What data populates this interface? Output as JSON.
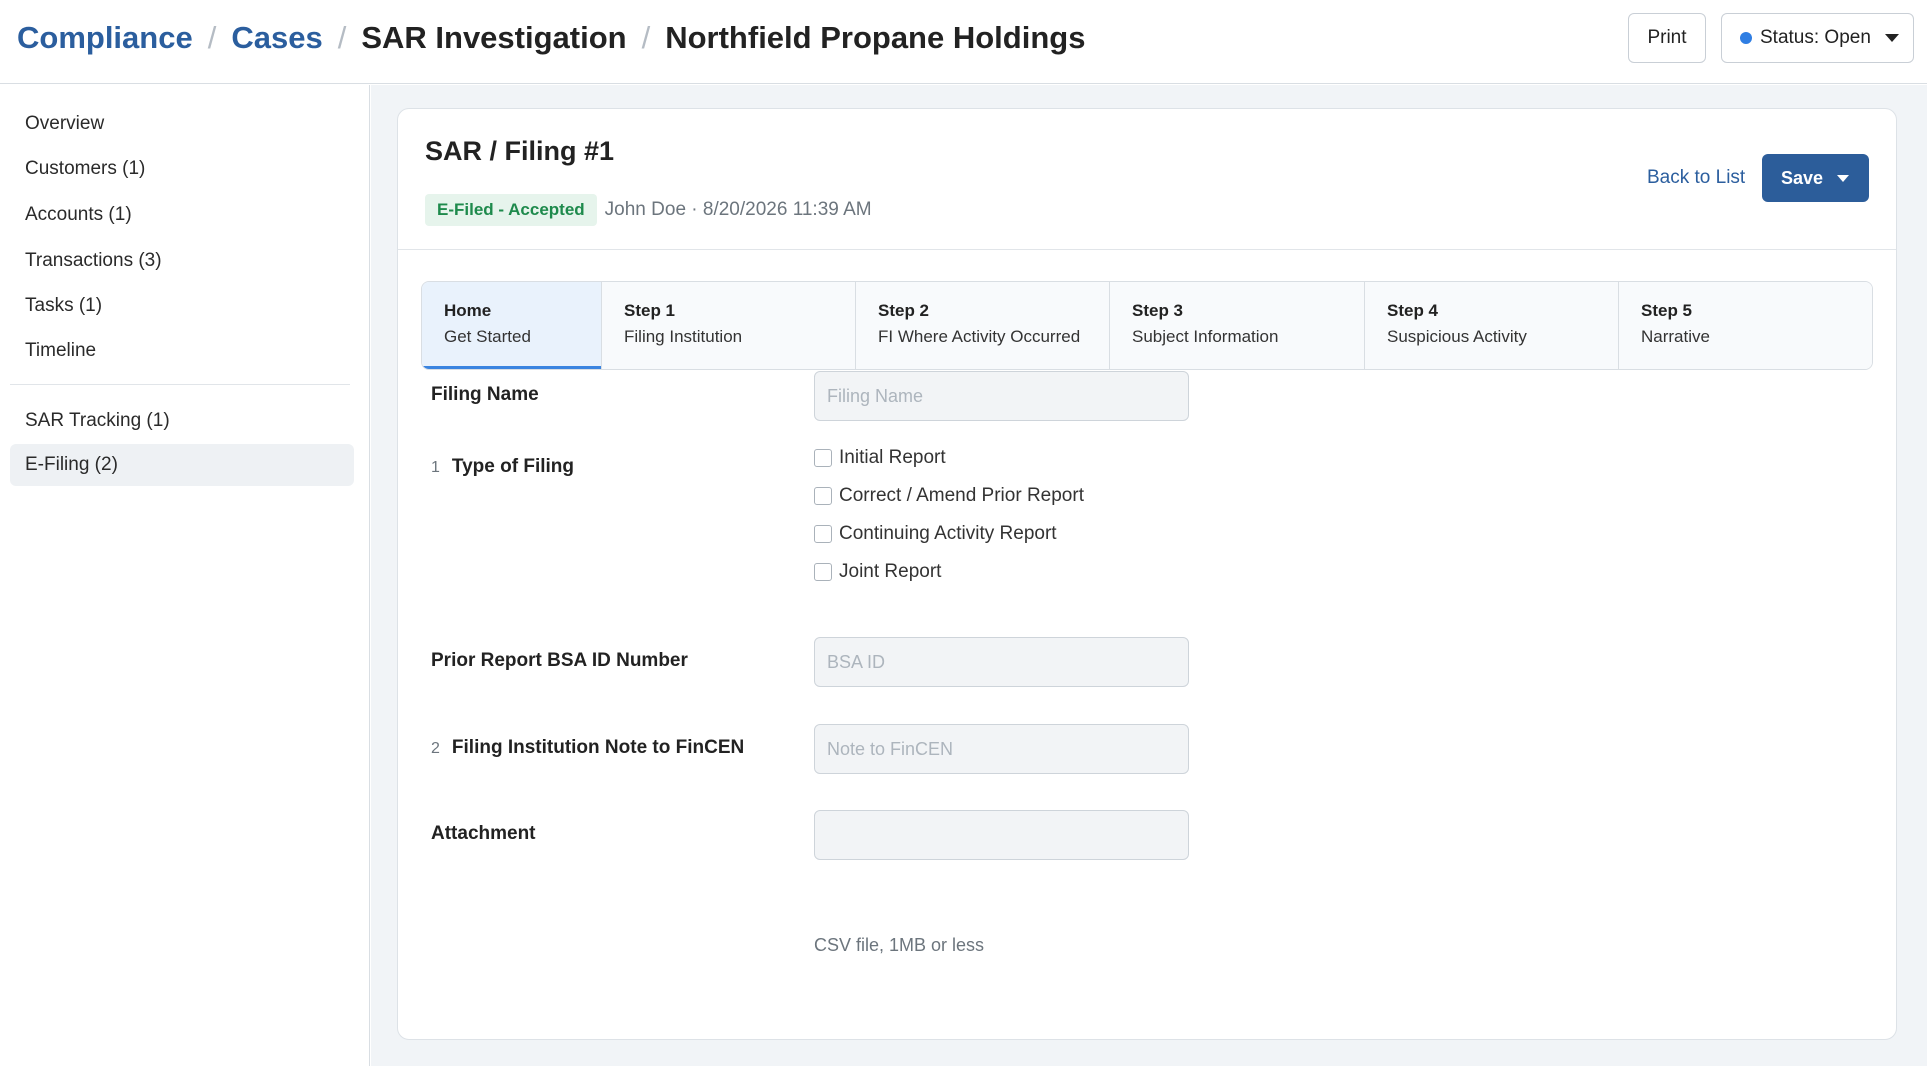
{
  "header": {
    "breadcrumb": [
      "Compliance",
      "Cases",
      "SAR Investigation",
      "Northfield Propane Holdings"
    ],
    "print_label": "Print",
    "status_label": "Status: Open",
    "status_color": "#2f7ee3"
  },
  "sidebar": {
    "items": [
      {
        "label": "Overview"
      },
      {
        "label": "Customers (1)"
      },
      {
        "label": "Accounts (1)"
      },
      {
        "label": "Transactions (3)"
      },
      {
        "label": "Tasks (1)"
      },
      {
        "label": "Timeline"
      },
      {
        "label": "SAR Tracking (1)"
      },
      {
        "label": "E-Filing (2)",
        "active": true
      }
    ]
  },
  "card": {
    "title": "SAR / Filing #1",
    "badge": "E-Filed - Accepted",
    "meta": "John Doe · 8/20/2026 11:39 AM",
    "back_label": "Back to List",
    "save_label": "Save"
  },
  "steps": [
    {
      "num": "Home",
      "name": "Get Started",
      "active": true
    },
    {
      "num": "Step 1",
      "name": "Filing Institution"
    },
    {
      "num": "Step 2",
      "name": "FI Where Activity Occurred"
    },
    {
      "num": "Step 3",
      "name": "Subject Information"
    },
    {
      "num": "Step 4",
      "name": "Suspicious Activity"
    },
    {
      "num": "Step 5",
      "name": "Narrative"
    }
  ],
  "form": {
    "filing_name": {
      "label": "Filing Name",
      "placeholder": "Filing Name",
      "value": ""
    },
    "type_of_filing": {
      "num": "1",
      "label": "Type of Filing",
      "options": [
        "Initial Report",
        "Correct / Amend Prior Report",
        "Continuing Activity Report",
        "Joint Report"
      ]
    },
    "prior_bsa": {
      "label": "Prior Report BSA ID Number",
      "placeholder": "BSA ID",
      "value": ""
    },
    "note": {
      "num": "2",
      "label": "Filing Institution Note to FinCEN",
      "placeholder": "Note to FinCEN",
      "value": ""
    },
    "attachment": {
      "label": "Attachment",
      "help": "CSV file, 1MB or less"
    }
  }
}
